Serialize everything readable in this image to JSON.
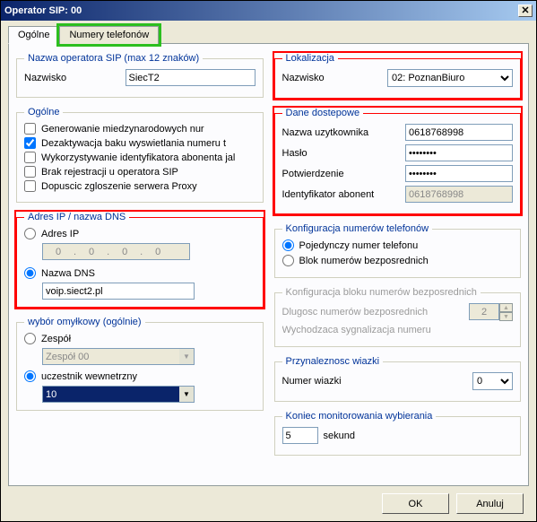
{
  "window": {
    "title": "Operator SIP:  00"
  },
  "tabs": {
    "general": "Ogólne",
    "phones": "Numery telefonów"
  },
  "op_name_group": {
    "legend": "Nazwa operatora SIP (max 12 znaków)",
    "label": "Nazwisko",
    "value": "SiecT2"
  },
  "location_group": {
    "legend": "Lokalizacja",
    "label": "Nazwisko",
    "value": "02: PoznanBiuro"
  },
  "general_group": {
    "legend": "Ogólne",
    "opt1": "Generowanie miedzynarodowych nur",
    "opt2": "Dezaktywacja baku wyswietlania numeru t",
    "opt3": "Wykorzystywanie identyfikatora abonenta jal",
    "opt4": "Brak rejestracji u operatora SIP",
    "opt5": "Dopuscic zgloszenie serwera Proxy"
  },
  "access_group": {
    "legend": "Dane dostepowe",
    "user_lbl": "Nazwa uzytkownika",
    "user_val": "0618768998",
    "pass_lbl": "Hasło",
    "pass_val": "xxxxxxxx",
    "confirm_lbl": "Potwierdzenie",
    "confirm_val": "xxxxxxxx",
    "id_lbl": "Identyfikator abonent",
    "id_val": "0618768998"
  },
  "dns_group": {
    "legend": "Adres IP / nazwa DNS",
    "ip_lbl": "Adres IP",
    "ip": [
      "0",
      "0",
      "0",
      "0"
    ],
    "dns_lbl": "Nazwa DNS",
    "dns_val": "voip.siect2.pl"
  },
  "numconf_group": {
    "legend": "Konfiguracja numerów telefonów",
    "single": "Pojedynczy numer telefonu",
    "block": "Blok numerów bezposrednich"
  },
  "blockconf_group": {
    "legend": "Konfiguracja bloku numerów bezposrednich",
    "len_lbl": "Dlugosc numerów bezposrednich",
    "len_val": "2",
    "sig_lbl": "Wychodzaca sygnalizacja numeru"
  },
  "fallback_group": {
    "legend": "wybór omyłkowy (ogólnie)",
    "team_lbl": "Zespół",
    "team_val": "Zespół 00",
    "internal_lbl": "uczestnik wewnetrzny",
    "internal_val": "10"
  },
  "bundle_group": {
    "legend": "Przynaleznosc wiazki",
    "lbl": "Numer wiazki",
    "val": "0"
  },
  "monitor_group": {
    "legend": "Koniec monitorowania wybierania",
    "val": "5",
    "unit": "sekund"
  },
  "buttons": {
    "ok": "OK",
    "cancel": "Anuluj"
  }
}
